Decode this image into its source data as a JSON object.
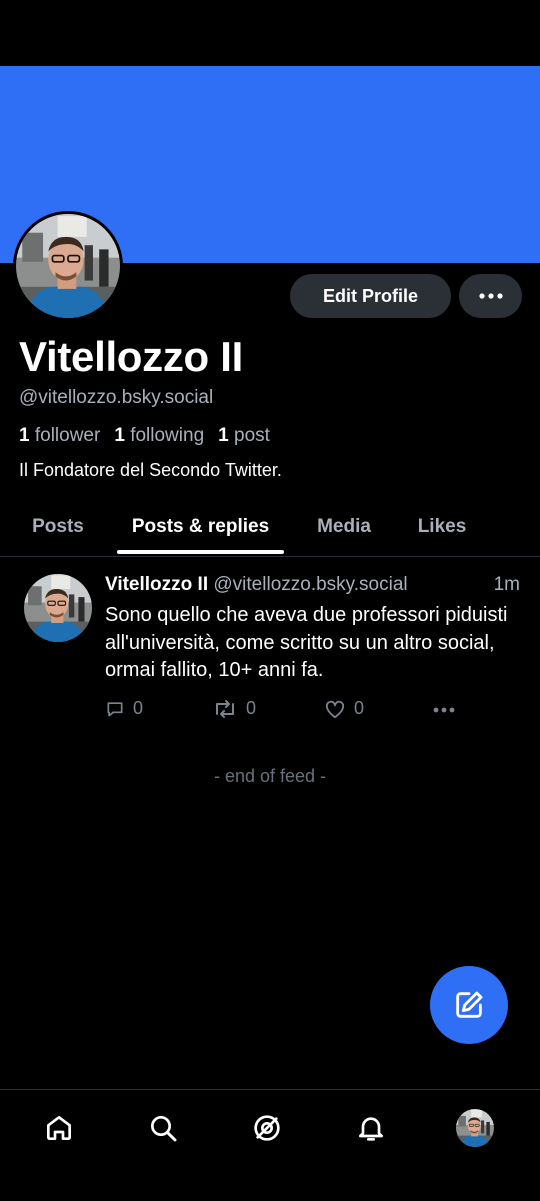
{
  "profile": {
    "display_name": "Vitellozzo II",
    "handle": "@vitellozzo.bsky.social",
    "followers_count": "1",
    "followers_label": "follower",
    "following_count": "1",
    "following_label": "following",
    "posts_count": "1",
    "posts_label": "post",
    "bio": "Il Fondatore del Secondo Twitter.",
    "banner_color": "#2f6ff6"
  },
  "buttons": {
    "edit_profile": "Edit Profile",
    "more_icon": "ellipsis-icon"
  },
  "tabs": [
    {
      "label": "Posts",
      "active": false
    },
    {
      "label": "Posts & replies",
      "active": true
    },
    {
      "label": "Media",
      "active": false
    },
    {
      "label": "Likes",
      "active": false
    }
  ],
  "post": {
    "author_name": "Vitellozzo II",
    "author_handle": "@vitellozzo.bsky.social",
    "time": "1m",
    "text": "Sono quello che aveva due professori piduisti all'università, come scritto su un altro social, ormai fallito, 10+ anni fa.",
    "reply_count": "0",
    "repost_count": "0",
    "like_count": "0"
  },
  "feed": {
    "end_text": "- end of feed -"
  },
  "nav": [
    "home-icon",
    "search-icon",
    "feeds-icon",
    "notifications-icon",
    "profile-avatar"
  ],
  "colors": {
    "accent": "#2f6ff6",
    "background": "#000000",
    "muted": "#a9b0bb"
  }
}
